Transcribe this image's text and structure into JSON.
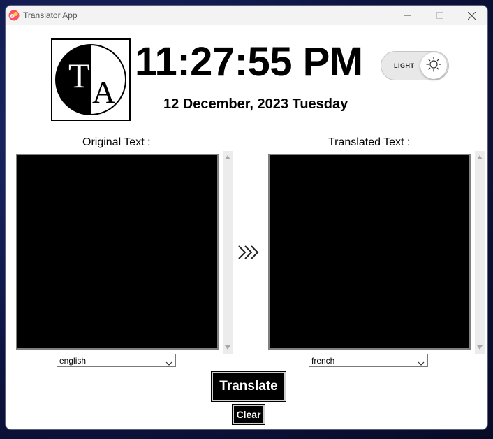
{
  "window": {
    "title": "Translator App",
    "icon": "translator-app-icon",
    "controls": [
      "minimize-icon",
      "maximize-icon",
      "close-icon"
    ]
  },
  "logo": {
    "letter_top": "T",
    "letter_bottom": "A"
  },
  "clock": {
    "time": "11:27:55 PM",
    "date": "12 December, 2023 Tuesday"
  },
  "theme_toggle": {
    "label": "LIGHT",
    "icon": "sun-icon"
  },
  "original": {
    "label": "Original Text :",
    "text": "",
    "language": "english"
  },
  "translated": {
    "label": "Translated Text :",
    "text": "",
    "language": "french"
  },
  "swap_icon": "triple-chevron-right-icon",
  "buttons": {
    "translate": "Translate",
    "clear": "Clear"
  },
  "colors": {
    "textbox_bg": "#000000",
    "button_bg": "#000000",
    "button_text": "#ffffff"
  }
}
